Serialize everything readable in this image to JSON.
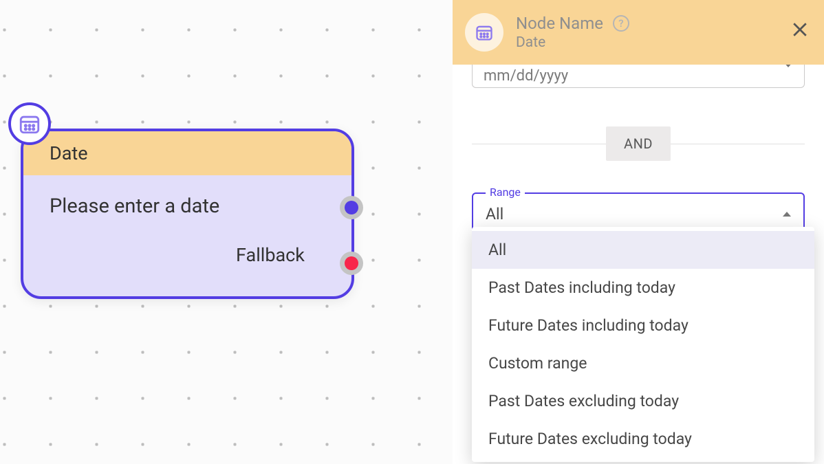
{
  "canvas": {
    "node": {
      "title": "Date",
      "prompt": "Please enter a date",
      "fallback": "Fallback"
    }
  },
  "panel": {
    "title": "Node Name",
    "subtitle": "Date",
    "date_placeholder": "mm/dd/yyyy",
    "connector": "AND",
    "range_label": "Range",
    "range_value": "All",
    "range_options": [
      "All",
      "Past Dates including today",
      "Future Dates including today",
      "Custom range",
      "Past Dates excluding today",
      "Future Dates excluding today"
    ]
  }
}
